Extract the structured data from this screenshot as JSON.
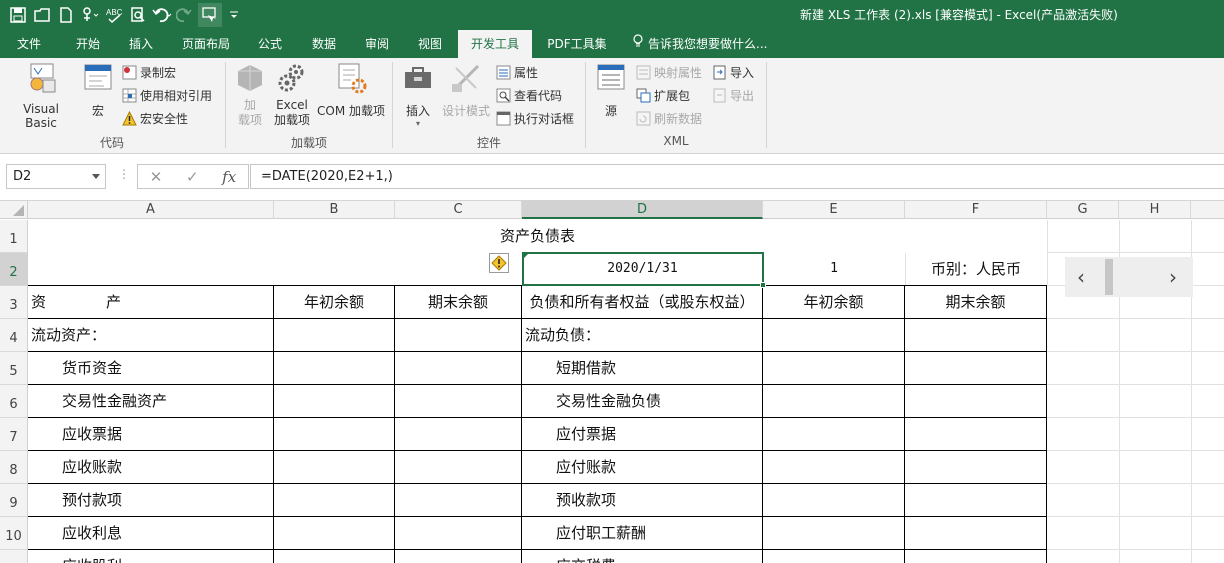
{
  "window": {
    "title": "新建 XLS 工作表 (2).xls  [兼容模式] - Excel(产品激活失败)"
  },
  "quick_access": {
    "icons": [
      "save-icon",
      "open-icon",
      "new-icon",
      "touch-mode-icon",
      "spelling-icon",
      "print-preview-icon",
      "undo-icon",
      "redo-icon",
      "custom-icon",
      "customize-qat-icon"
    ]
  },
  "tabs": [
    {
      "label": "文件"
    },
    {
      "label": "开始"
    },
    {
      "label": "插入"
    },
    {
      "label": "页面布局"
    },
    {
      "label": "公式"
    },
    {
      "label": "数据"
    },
    {
      "label": "审阅"
    },
    {
      "label": "视图"
    },
    {
      "label": "开发工具"
    },
    {
      "label": "PDF工具集"
    },
    {
      "label": "告诉我您想要做什么..."
    }
  ],
  "ribbon": {
    "code": {
      "label": "代码",
      "visual_basic": "Visual Basic",
      "macros": "宏",
      "record_macro": "录制宏",
      "relative_ref": "使用相对引用",
      "macro_security": "宏安全性"
    },
    "addins": {
      "label": "加载项",
      "addins_line1": "加",
      "addins_line2": "载项",
      "excel_addins_line1": "Excel",
      "excel_addins_line2": "加载项",
      "com_addins": "COM 加载项"
    },
    "controls": {
      "label": "控件",
      "insert": "插入",
      "design_mode": "设计模式",
      "properties": "属性",
      "view_code": "查看代码",
      "run_dialog": "执行对话框"
    },
    "xml": {
      "label": "XML",
      "source": "源",
      "map_properties": "映射属性",
      "expansion_packs": "扩展包",
      "refresh_data": "刷新数据",
      "import": "导入",
      "export": "导出"
    }
  },
  "formula_bar": {
    "name_box": "D2",
    "cancel": "✕",
    "enter": "✓",
    "fx": "fx",
    "formula": "=DATE(2020,E2+1,)"
  },
  "columns": [
    "A",
    "B",
    "C",
    "D",
    "E",
    "F",
    "G",
    "H"
  ],
  "rows": [
    "1",
    "2",
    "3",
    "4",
    "5",
    "6",
    "7",
    "8",
    "9",
    "10"
  ],
  "sheet": {
    "title": "资产负债表",
    "date": "2020/1/31",
    "month": "1",
    "currency": "币别：人民币",
    "header": {
      "assets": "资　　　　产",
      "begin_a": "年初余额",
      "end_a": "期末余额",
      "liabilities": "负债和所有者权益（或股东权益）",
      "begin_l": "年初余额",
      "end_l": "期末余额"
    },
    "rows": [
      {
        "asset": "流动资产：",
        "liab": "流动负债："
      },
      {
        "asset": "货币资金",
        "liab": "短期借款"
      },
      {
        "asset": "交易性金融资产",
        "liab": "交易性金融负债"
      },
      {
        "asset": "应收票据",
        "liab": "应付票据"
      },
      {
        "asset": "应收账款",
        "liab": "应付账款"
      },
      {
        "asset": "预付款项",
        "liab": "预收款项"
      },
      {
        "asset": "应收利息",
        "liab": "应付职工薪酬"
      },
      {
        "asset": "应收股利",
        "liab": "应交税费"
      }
    ]
  },
  "widget": {
    "prev": "‹",
    "next": "›"
  }
}
